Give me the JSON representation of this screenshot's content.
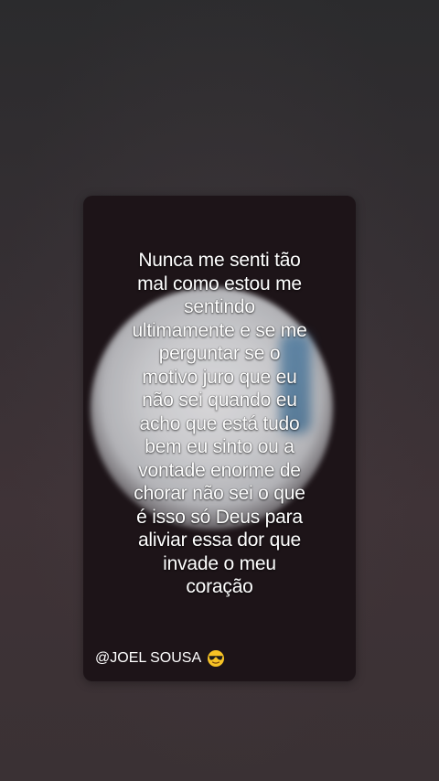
{
  "story": {
    "quote_lines": [
      "Nunca me senti tão",
      "mal como estou me",
      "sentindo",
      "ultimamente e se me",
      "perguntar se o",
      "motivo juro que eu",
      "não sei quando eu",
      "acho que está tudo",
      "bem eu sinto ou a",
      "vontade enorme de",
      "chorar não sei o que",
      "é isso só Deus para",
      "aliviar essa dor que",
      "invade o meu",
      "coração"
    ],
    "signature": "@JOEL SOUSA",
    "signature_icon": "sunglasses-emoji-icon"
  },
  "colors": {
    "card_background": "#1d1418",
    "text": "#ffffff",
    "emoji_face": "#f7c325"
  }
}
